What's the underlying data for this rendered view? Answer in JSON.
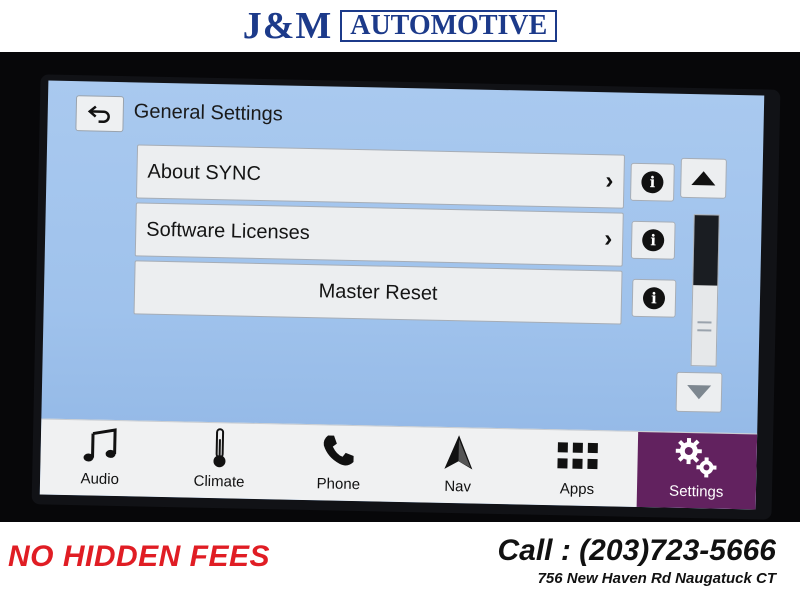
{
  "banner": {
    "brand": "J&M",
    "subtitle": "AUTOMOTIVE"
  },
  "screen": {
    "title": "General Settings",
    "menu": [
      {
        "label": "About SYNC",
        "has_chevron": true
      },
      {
        "label": "Software Licenses",
        "has_chevron": true
      },
      {
        "label": "Master Reset",
        "has_chevron": false
      }
    ],
    "info_icon_glyph": "i",
    "chevron_glyph": "›",
    "nav": [
      {
        "label": "Audio",
        "icon": "music-note-icon"
      },
      {
        "label": "Climate",
        "icon": "thermometer-icon"
      },
      {
        "label": "Phone",
        "icon": "phone-icon"
      },
      {
        "label": "Nav",
        "icon": "navigation-arrow-icon"
      },
      {
        "label": "Apps",
        "icon": "apps-grid-icon"
      },
      {
        "label": "Settings",
        "icon": "gears-icon",
        "active": true
      }
    ],
    "colors": {
      "screen_bg": "#a9c9ef",
      "active_tab": "#62225f"
    }
  },
  "footer": {
    "tagline": "NO HIDDEN FEES",
    "phone": "Call : (203)723-5666",
    "address": "756 New Haven Rd Naugatuck CT"
  }
}
